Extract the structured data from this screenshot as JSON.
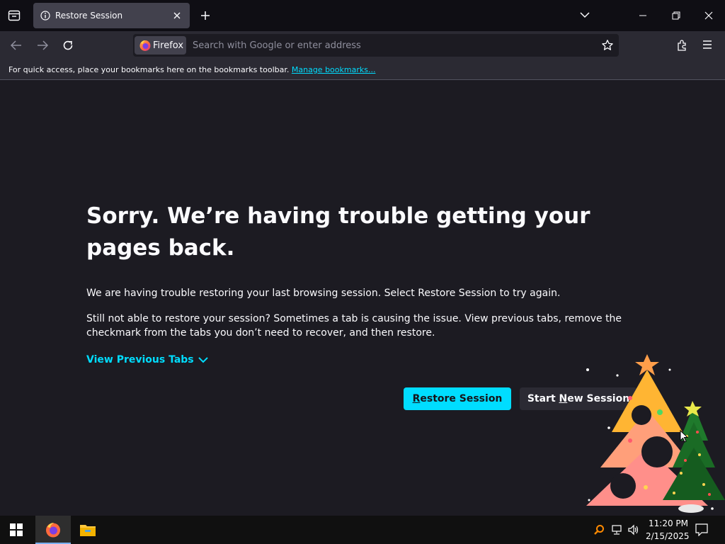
{
  "window": {
    "tab_title": "Restore Session",
    "tab_icon": "info-icon",
    "controls": [
      "list-all-tabs-icon",
      "minimize-icon",
      "restore-icon",
      "close-icon"
    ]
  },
  "navbar": {
    "identity_label": "Firefox",
    "url_placeholder": "Search with Google or enter address"
  },
  "bookmarks_bar": {
    "message": "For quick access, place your bookmarks here on the bookmarks toolbar.",
    "link_label": "Manage bookmarks..."
  },
  "main": {
    "title": "Sorry. We’re having trouble getting your pages back.",
    "paragraph1": "We are having trouble restoring your last browsing session. Select Restore Session to try again.",
    "paragraph2": "Still not able to restore your session? Sometimes a tab is causing the issue. View previous tabs, remove the checkmark from the tabs you don’t need to recover, and then restore.",
    "view_previous_tabs": "View Previous Tabs",
    "restore_button": {
      "mnemonic": "R",
      "rest": "estore Session"
    },
    "new_session_button": {
      "before": "Start ",
      "mnemonic": "N",
      "after": "ew Session"
    }
  },
  "taskbar": {
    "time": "11:20 PM",
    "date": "2/15/2025",
    "apps": [
      "firefox",
      "file-explorer"
    ]
  },
  "colors": {
    "accent": "#00ddff",
    "page_background": "#1c1b22",
    "toolbar": "#2b2a33",
    "tabstrip": "#0f0e14"
  }
}
